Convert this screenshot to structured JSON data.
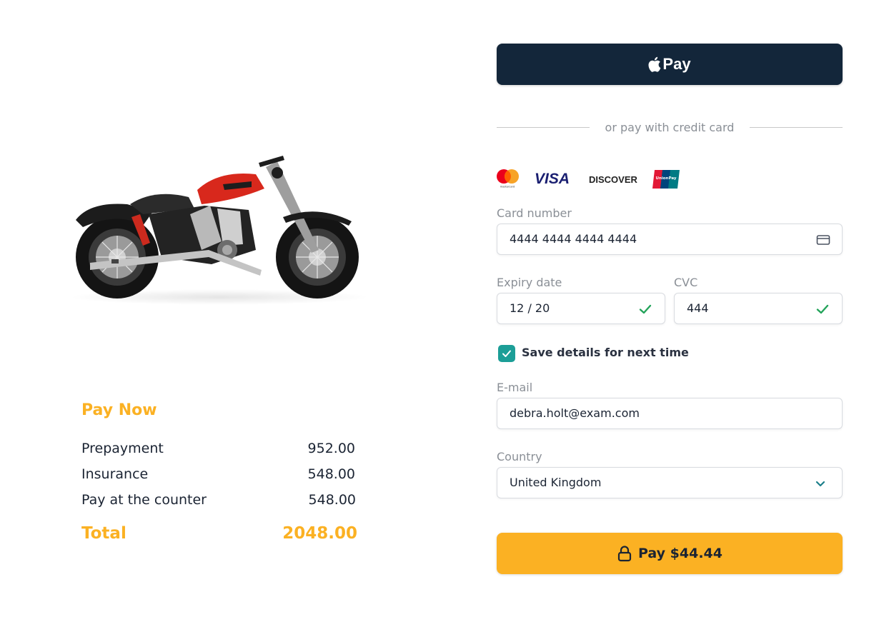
{
  "product": {
    "image_icon": "motorcycle-image"
  },
  "summary": {
    "title": "Pay Now",
    "lines": [
      {
        "label": "Prepayment",
        "amount": "952.00"
      },
      {
        "label": "Insurance",
        "amount": "548.00"
      },
      {
        "label": "Pay at the counter",
        "amount": "548.00"
      }
    ],
    "total_label": "Total",
    "total_amount": "2048.00"
  },
  "payment": {
    "apple_pay_label": "Pay",
    "divider_text": "or pay with credit card",
    "card_brands": [
      "mastercard",
      "VISA",
      "DISCOVER",
      "UnionPay"
    ],
    "card_number": {
      "label": "Card number",
      "value": "4444 4444 4444 4444",
      "icon": "credit-card-icon"
    },
    "expiry": {
      "label": "Expiry date",
      "value": "12 / 20",
      "icon": "check-icon"
    },
    "cvc": {
      "label": "CVC",
      "value": "444",
      "icon": "check-icon"
    },
    "save_details": {
      "label": "Save details for next time",
      "checked": true
    },
    "email": {
      "label": "E-mail",
      "value": "debra.holt@exam.com"
    },
    "country": {
      "label": "Country",
      "value": "United Kingdom",
      "icon": "chevron-down-icon"
    },
    "pay_button_label": "Pay $44.44"
  },
  "colors": {
    "accent": "#fbb123",
    "apple_pay_bg": "#13263a",
    "checkbox": "#1c9e97",
    "valid_check": "#23a35a",
    "text": "#1b2433",
    "muted": "#8a8f96"
  }
}
